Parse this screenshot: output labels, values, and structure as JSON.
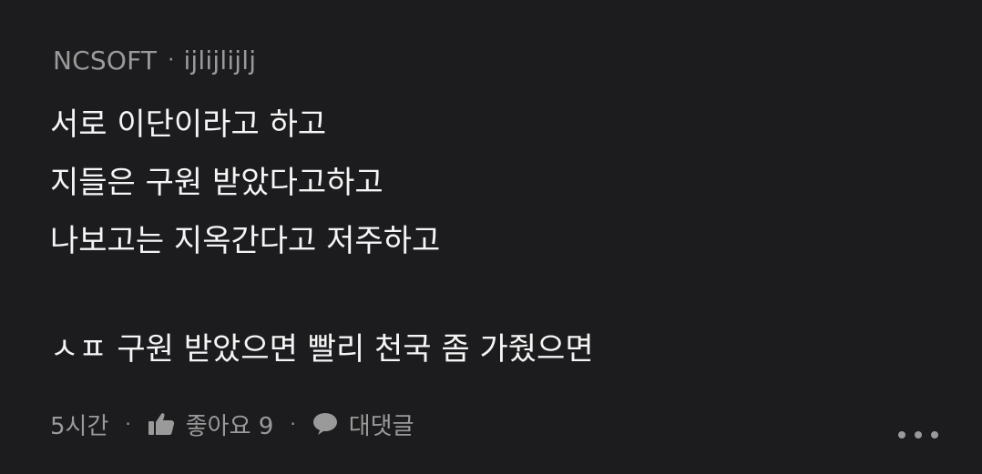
{
  "comment": {
    "author": "NCSOFT",
    "separator": "·",
    "username": "ijlijlijlj",
    "lines": [
      "서로 이단이라고 하고",
      "지들은 구원 받았다고하고",
      "나보고는 지옥간다고 저주하고",
      "ㅅㅍ 구원 받았으면 빨리 천국 좀 가줬으면"
    ],
    "footer": {
      "time": "5시간",
      "dot": "·",
      "like_icon": "thumbs-up-icon",
      "like_label": "좋아요 9",
      "reply_icon": "speech-bubble-icon",
      "reply_label": "대댓글"
    },
    "more_icon": "more-dots-icon"
  }
}
